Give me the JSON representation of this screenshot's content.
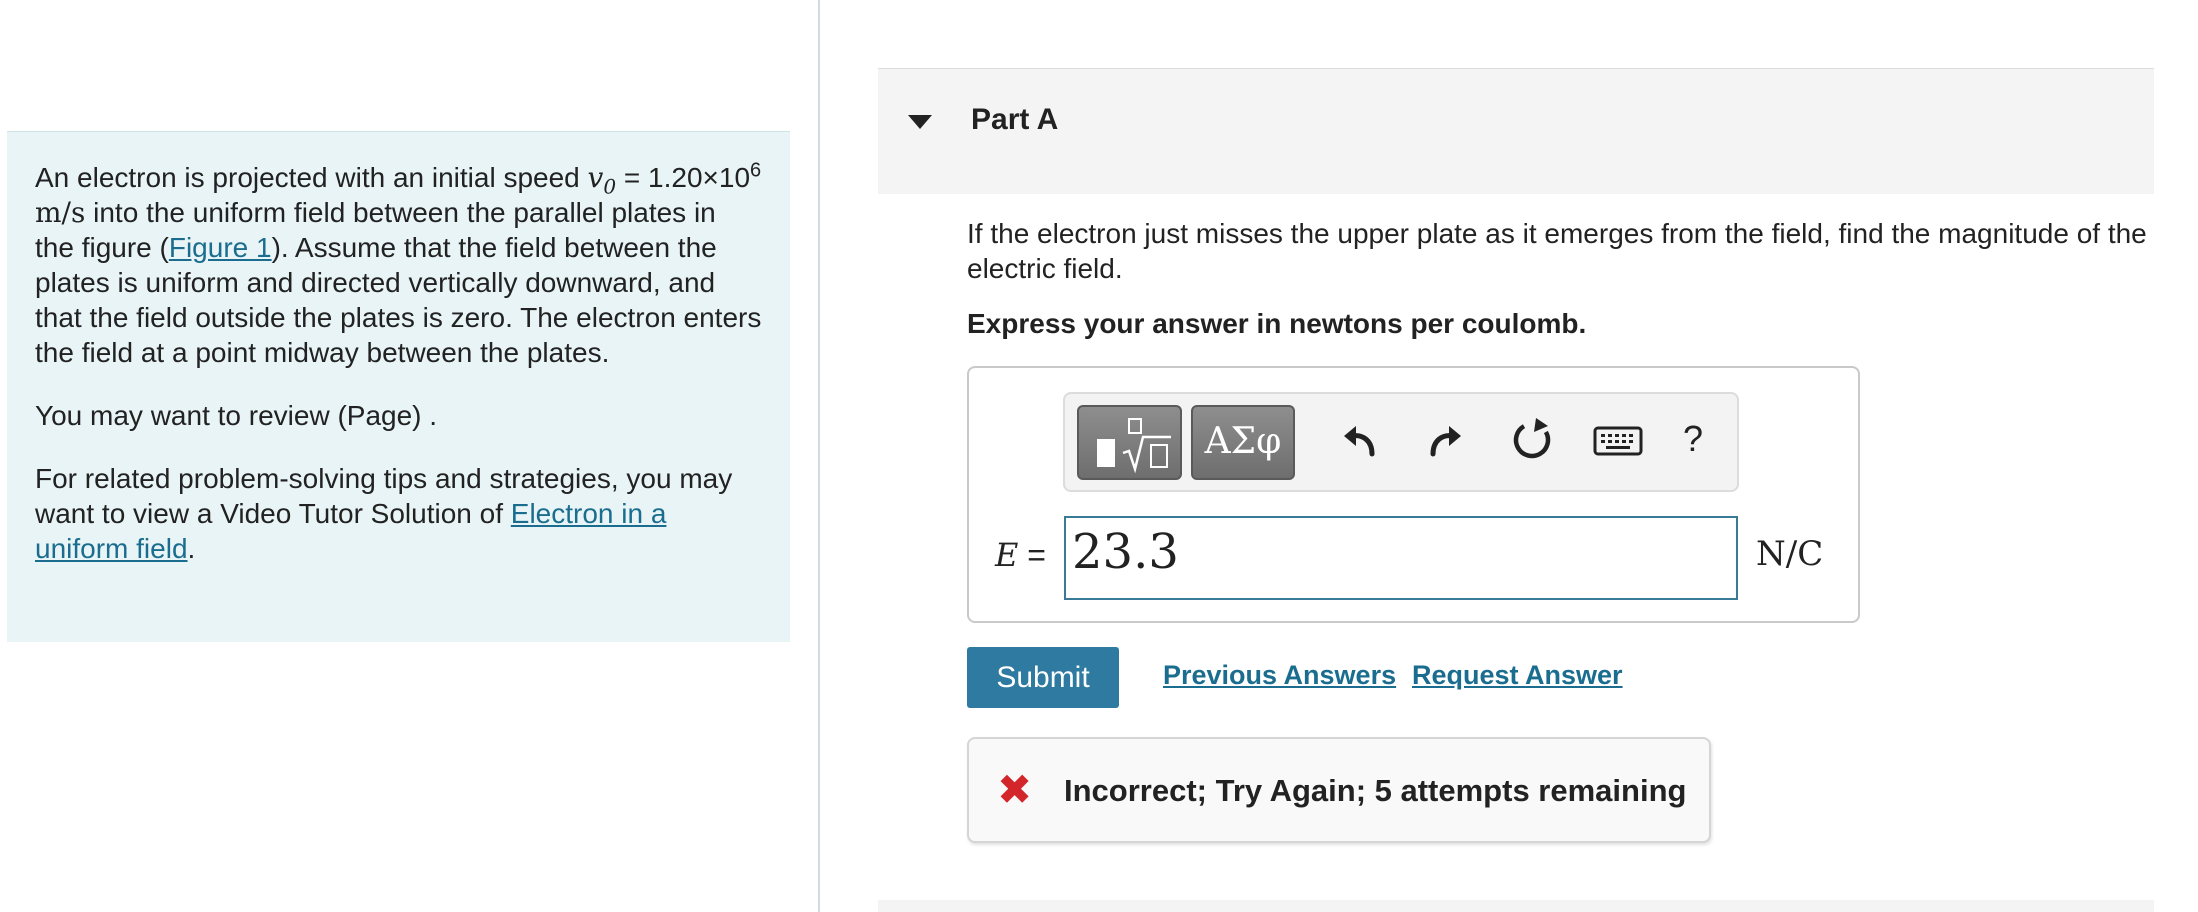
{
  "problem": {
    "intro_1": "An electron is projected with an initial speed ",
    "v_symbol": "v",
    "v_sub": "0",
    "equals": " =",
    "speed_value": "1.20×10",
    "speed_exp": "6",
    "speed_unit": "m/s",
    "intro_2": " into the uniform field between the parallel plates in the figure (",
    "figure_link": "Figure 1",
    "intro_3": "). Assume that the field between the plates is uniform and directed vertically downward, and that the field outside the plates is zero. The electron enters the field at a point midway between the plates.",
    "review_text": "You may want to review (Page) .",
    "tips_text": "For related problem-solving tips and strategies, you may want to view a Video Tutor Solution of ",
    "video_link": "Electron in a uniform field",
    "period": "."
  },
  "part": {
    "title": "Part A",
    "question": "If the electron just misses the upper plate as it emerges from the field, find the magnitude of the electric field.",
    "instruction": "Express your answer in newtons per coulomb."
  },
  "toolbar": {
    "greek_label": "ΑΣφ",
    "help_label": "?"
  },
  "answer": {
    "variable": "E",
    "equals": "=",
    "value": "23.3",
    "units": "N/C"
  },
  "actions": {
    "submit_label": "Submit",
    "previous_answers_label": "Previous Answers",
    "request_answer_label": "Request Answer"
  },
  "feedback": {
    "icon": "x-icon",
    "message": "Incorrect; Try Again; 5 attempts remaining",
    "color": "#d3262b"
  },
  "colors": {
    "accent": "#2e7aa0",
    "link": "#1b6d8f",
    "panel_bg": "#e8f4f6"
  }
}
